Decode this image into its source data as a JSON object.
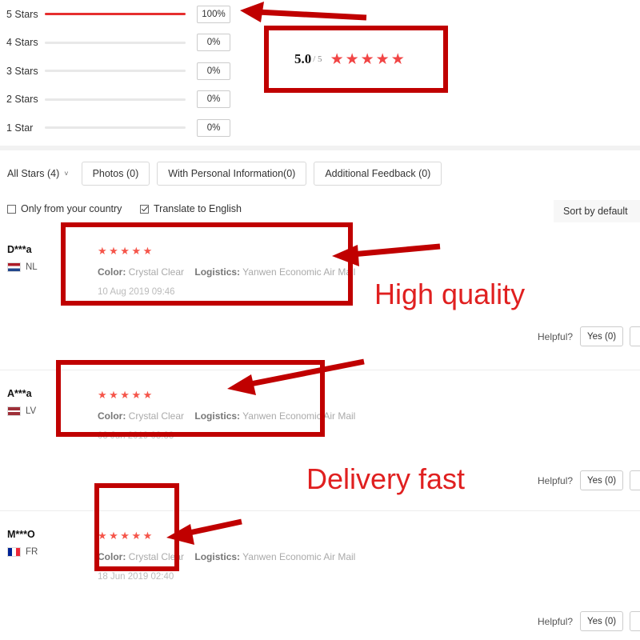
{
  "rating_breakdown": {
    "rows": [
      {
        "label": "5 Stars",
        "percent_label": "100%",
        "percent": 100
      },
      {
        "label": "4 Stars",
        "percent_label": "0%",
        "percent": 0
      },
      {
        "label": "3 Stars",
        "percent_label": "0%",
        "percent": 0
      },
      {
        "label": "2 Stars",
        "percent_label": "0%",
        "percent": 0
      },
      {
        "label": "1 Star",
        "percent_label": "0%",
        "percent": 0
      }
    ],
    "bar_fill_color": "#e62e2e",
    "bar_track_color": "#e8e8e8"
  },
  "score_summary": {
    "value": "5.0",
    "denominator": "/ 5",
    "stars": "★★★★★",
    "star_color": "#f14545"
  },
  "filters": {
    "star_filter_label": "All Stars (4)",
    "chevron_icon": "˅",
    "chips": [
      "Photos (0)",
      "With Personal Information(0)",
      "Additional Feedback (0)"
    ]
  },
  "options": {
    "only_country": {
      "label": "Only from your country",
      "checked": false
    },
    "translate": {
      "label": "Translate to English",
      "checked": true
    },
    "sort_label": "Sort by default"
  },
  "reviews": [
    {
      "name": "D***a",
      "country_code": "NL",
      "flag": "flag-nl",
      "stars": "★★★★★",
      "color_key": "Color:",
      "color_value": "Crystal Clear",
      "logistics_key": "Logistics:",
      "logistics_value": "Yanwen Economic Air Mail",
      "date": "10 Aug 2019 09:46",
      "helpful_label": "Helpful?",
      "yes_label": "Yes (0)",
      "no_label": "N"
    },
    {
      "name": "A***a",
      "country_code": "LV",
      "flag": "flag-lv",
      "stars": "★★★★★",
      "color_key": "Color:",
      "color_value": "Crystal Clear",
      "logistics_key": "Logistics:",
      "logistics_value": "Yanwen Economic Air Mail",
      "date": "03 Jun 2019 03:33",
      "helpful_label": "Helpful?",
      "yes_label": "Yes (0)",
      "no_label": "N"
    },
    {
      "name": "M***O",
      "country_code": "FR",
      "flag": "flag-fr",
      "stars": "★★★★★",
      "color_key": "Color:",
      "color_value": "Crystal Clear",
      "logistics_key": "Logistics:",
      "logistics_value": "Yanwen Economic Air Mail",
      "date": "18 Jun 2019 02:40",
      "helpful_label": "Helpful?",
      "yes_label": "Yes (0)",
      "no_label": "N"
    }
  ],
  "annotations": {
    "color": "#c00000",
    "text_color": "#e02020",
    "labels": [
      {
        "text": "High quality"
      },
      {
        "text": "Delivery fast"
      }
    ]
  }
}
